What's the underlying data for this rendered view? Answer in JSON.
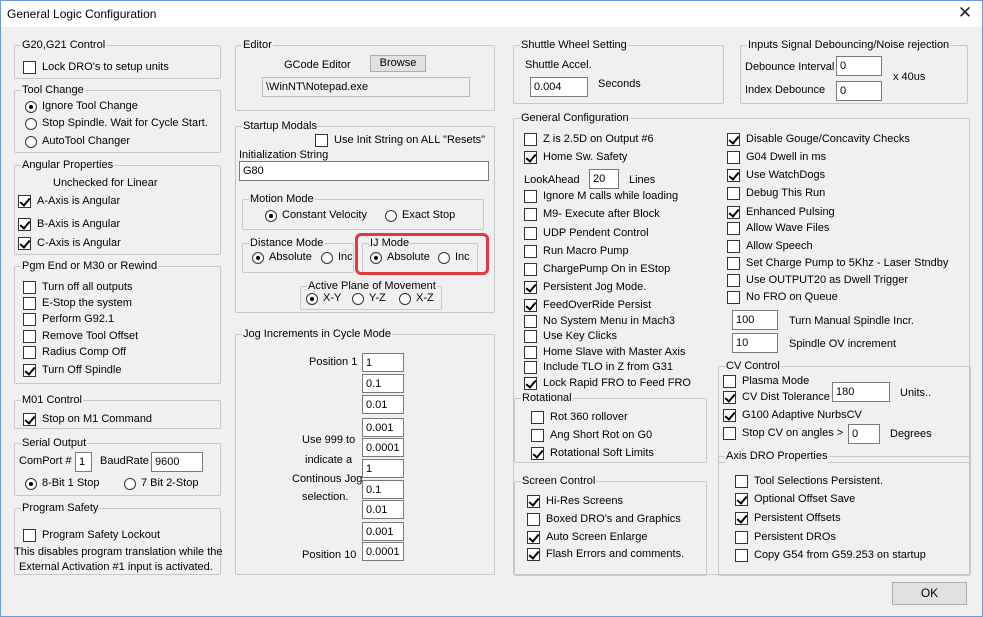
{
  "window": {
    "title": "General Logic Configuration",
    "close_glyph": "✕"
  },
  "g20": {
    "legend": "G20,G21 Control",
    "lock_dro": {
      "label": "Lock DRO's to setup units",
      "checked": false
    }
  },
  "tool_change": {
    "legend": "Tool Change",
    "options": [
      "Ignore Tool Change",
      "Stop Spindle. Wait for Cycle Start.",
      "AutoTool Changer"
    ],
    "selected": 0
  },
  "angular": {
    "legend": "Angular Properties",
    "note": "Unchecked for Linear",
    "items": [
      {
        "label": "A-Axis is Angular",
        "checked": true
      },
      {
        "label": "B-Axis is Angular",
        "checked": true
      },
      {
        "label": "C-Axis is Angular",
        "checked": true
      }
    ]
  },
  "pgm_end": {
    "legend": "Pgm End or M30 or Rewind",
    "items": [
      {
        "label": "Turn off all outputs",
        "checked": false
      },
      {
        "label": "E-Stop the system",
        "checked": false
      },
      {
        "label": "Perform G92.1",
        "checked": false
      },
      {
        "label": "Remove Tool Offset",
        "checked": false
      },
      {
        "label": "Radius Comp Off",
        "checked": false
      },
      {
        "label": "Turn Off Spindle",
        "checked": true
      }
    ]
  },
  "m01": {
    "legend": "M01 Control",
    "stop": {
      "label": "Stop on M1 Command",
      "checked": true
    }
  },
  "serial": {
    "legend": "Serial Output",
    "comport_label": "ComPort #",
    "comport_value": "1",
    "baud_label": "BaudRate",
    "baud_value": "9600",
    "options": [
      "8-Bit 1 Stop",
      "7 Bit 2-Stop"
    ],
    "selected": 0
  },
  "program_safety": {
    "legend": "Program Safety",
    "lockout": {
      "label": "Program Safety Lockout",
      "checked": false
    },
    "note_line1": "This disables program translation while the",
    "note_line2": "External Activation #1 input is activated."
  },
  "editor": {
    "legend": "Editor",
    "label": "GCode Editor",
    "browse": "Browse",
    "path": "\\WinNT\\Notepad.exe"
  },
  "startup": {
    "legend": "Startup Modals",
    "use_init": {
      "label": "Use Init String on ALL  \"Resets\"",
      "checked": false
    },
    "init_label": "Initialization String",
    "init_value": "G80",
    "motion": {
      "legend": "Motion Mode",
      "options": [
        "Constant Velocity",
        "Exact Stop"
      ],
      "selected": 0
    },
    "distance": {
      "legend": "Distance Mode",
      "options": [
        "Absolute",
        "Inc"
      ],
      "selected": 0
    },
    "ij": {
      "legend": "IJ Mode",
      "options": [
        "Absolute",
        "Inc"
      ],
      "selected": 0
    },
    "plane": {
      "legend": "Active Plane of Movement",
      "options": [
        "X-Y",
        "Y-Z",
        "X-Z"
      ],
      "selected": 0
    }
  },
  "jog": {
    "legend": "Jog Increments in Cycle Mode",
    "pos1": "Position 1",
    "pos10": "Position 10",
    "note": [
      "Use 999 to",
      "indicate a",
      "Continous Jog",
      "selection."
    ],
    "values": [
      "1",
      "0.1",
      "0.01",
      "0.001",
      "0.0001",
      "1",
      "0.1",
      "0.01",
      "0.001",
      "0.0001"
    ]
  },
  "shuttle": {
    "legend": "Shuttle Wheel Setting",
    "accel_label": "Shuttle Accel.",
    "accel_value": "0.004",
    "unit": "Seconds"
  },
  "debounce": {
    "legend": "Inputs Signal Debouncing/Noise rejection",
    "interval_label": "Debounce Interval",
    "interval_value": "0",
    "index_label": "Index Debounce",
    "index_value": "0",
    "unit": "x 40us"
  },
  "general": {
    "legend": "General Configuration",
    "z25": {
      "label": "Z is 2.5D on Output #6",
      "checked": false
    },
    "home_safety": {
      "label": "Home Sw. Safety",
      "checked": true
    },
    "lookahead_label": "LookAhead",
    "lookahead_value": "20",
    "lines_label": "Lines",
    "left_items": [
      {
        "label": "Ignore M calls while loading",
        "checked": false
      },
      {
        "label": "M9- Execute after Block",
        "checked": false
      },
      {
        "label": "UDP Pendent Control",
        "checked": false
      },
      {
        "label": "Run Macro Pump",
        "checked": false
      },
      {
        "label": "ChargePump On in EStop",
        "checked": false
      },
      {
        "label": "Persistent Jog Mode.",
        "checked": true
      },
      {
        "label": "FeedOverRide Persist",
        "checked": true
      },
      {
        "label": "No System Menu in Mach3",
        "checked": false
      },
      {
        "label": "Use Key Clicks",
        "checked": false
      },
      {
        "label": "Home Slave with Master Axis",
        "checked": false
      },
      {
        "label": "Include TLO in Z from G31",
        "checked": false
      },
      {
        "label": "Lock Rapid FRO to Feed FRO",
        "checked": true
      }
    ],
    "right_items": [
      {
        "label": "Disable Gouge/Concavity Checks",
        "checked": true
      },
      {
        "label": "G04 Dwell in ms",
        "checked": false
      },
      {
        "label": "Use WatchDogs",
        "checked": true
      },
      {
        "label": "Debug This Run",
        "checked": false
      },
      {
        "label": "Enhanced Pulsing",
        "checked": true
      },
      {
        "label": "Allow Wave Files",
        "checked": false
      },
      {
        "label": "Allow Speech",
        "checked": false
      },
      {
        "label": "Set Charge Pump to 5Khz  - Laser Stndby",
        "checked": false
      },
      {
        "label": "Use OUTPUT20 as Dwell Trigger",
        "checked": false
      },
      {
        "label": "No FRO on Queue",
        "checked": false
      }
    ],
    "spindle_incr_value": "100",
    "spindle_incr_label": "Turn Manual Spindle Incr.",
    "spindle_ov_value": "10",
    "spindle_ov_label": "Spindle OV increment"
  },
  "rotational": {
    "legend": "Rotational",
    "items": [
      {
        "label": "Rot 360 rollover",
        "checked": false
      },
      {
        "label": "Ang Short Rot on G0",
        "checked": false
      },
      {
        "label": "Rotational Soft Limits",
        "checked": true
      }
    ]
  },
  "cv": {
    "legend": "CV Control",
    "plasma": {
      "label": "Plasma Mode",
      "checked": false
    },
    "dist_tol": {
      "label": "CV Dist Tolerance",
      "checked": true,
      "value": "180",
      "unit": "Units.."
    },
    "g100": {
      "label": "G100 Adaptive NurbsCV",
      "checked": true
    },
    "stop_cv": {
      "label": "Stop CV on angles >",
      "checked": false,
      "value": "0",
      "unit": "Degrees"
    }
  },
  "screen": {
    "legend": "Screen Control",
    "items": [
      {
        "label": "Hi-Res Screens",
        "checked": true
      },
      {
        "label": "Boxed DRO's and Graphics",
        "checked": false
      },
      {
        "label": "Auto Screen Enlarge",
        "checked": true
      },
      {
        "label": "Flash Errors and comments.",
        "checked": true
      }
    ]
  },
  "axis_dro": {
    "legend": "Axis DRO Properties",
    "items": [
      {
        "label": "Tool Selections Persistent.",
        "checked": false
      },
      {
        "label": "Optional Offset Save",
        "checked": true
      },
      {
        "label": "Persistent Offsets",
        "checked": true
      },
      {
        "label": "Persistent DROs",
        "checked": false
      },
      {
        "label": "Copy G54 from G59.253 on startup",
        "checked": false
      }
    ]
  },
  "ok": "OK"
}
